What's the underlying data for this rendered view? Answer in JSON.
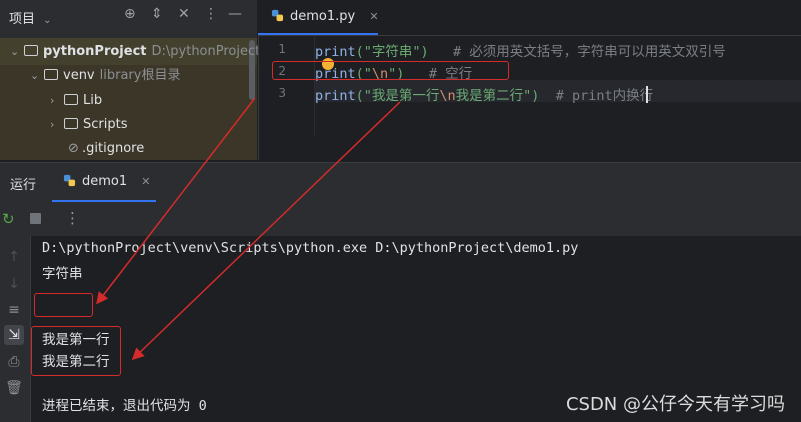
{
  "project_panel": {
    "title": "项目",
    "tree": [
      {
        "name": "pythonProject",
        "hint": "D:\\pythonProject"
      },
      {
        "name": "venv",
        "hint": "library根目录"
      },
      {
        "name": "Lib",
        "hint": ""
      },
      {
        "name": "Scripts",
        "hint": ""
      },
      {
        "name": ".gitignore",
        "hint": ""
      }
    ]
  },
  "editor": {
    "tab": "demo1.py",
    "lines": [
      {
        "num": "1",
        "fn": "print",
        "open": "(\"",
        "text": "字符串",
        "close": "\")",
        "comment": "   # 必须用英文括号，字符串可以用英文双引号"
      },
      {
        "num": "2",
        "fn": "print",
        "open": "(\"",
        "text": "\\n",
        "close": "\")",
        "comment": "   # 空行"
      },
      {
        "num": "3",
        "fn": "print",
        "open": "(\"",
        "text_a": "我是第一行",
        "esc": "\\n",
        "text_b": "我是第二行",
        "close": "\")",
        "comment": "  # print内换行"
      }
    ]
  },
  "run": {
    "label": "运行",
    "tab": "demo1",
    "console": [
      "D:\\pythonProject\\venv\\Scripts\\python.exe D:\\pythonProject\\demo1.py",
      "字符串",
      "",
      "我是第一行",
      "我是第二行",
      "",
      "进程已结束，退出代码为 0"
    ]
  },
  "watermark": "CSDN @公仔今天有学习吗",
  "colors": {
    "accent": "#3574f0",
    "annotation": "#d52b2b",
    "string": "#6aab73",
    "keyword": "#8fb3e8"
  }
}
